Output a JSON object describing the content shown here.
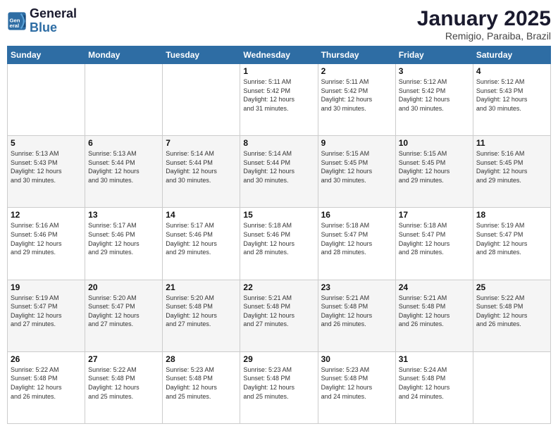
{
  "logo": {
    "line1": "General",
    "line2": "Blue"
  },
  "title": "January 2025",
  "subtitle": "Remigio, Paraiba, Brazil",
  "days_header": [
    "Sunday",
    "Monday",
    "Tuesday",
    "Wednesday",
    "Thursday",
    "Friday",
    "Saturday"
  ],
  "weeks": [
    [
      {
        "num": "",
        "info": ""
      },
      {
        "num": "",
        "info": ""
      },
      {
        "num": "",
        "info": ""
      },
      {
        "num": "1",
        "info": "Sunrise: 5:11 AM\nSunset: 5:42 PM\nDaylight: 12 hours\nand 31 minutes."
      },
      {
        "num": "2",
        "info": "Sunrise: 5:11 AM\nSunset: 5:42 PM\nDaylight: 12 hours\nand 30 minutes."
      },
      {
        "num": "3",
        "info": "Sunrise: 5:12 AM\nSunset: 5:42 PM\nDaylight: 12 hours\nand 30 minutes."
      },
      {
        "num": "4",
        "info": "Sunrise: 5:12 AM\nSunset: 5:43 PM\nDaylight: 12 hours\nand 30 minutes."
      }
    ],
    [
      {
        "num": "5",
        "info": "Sunrise: 5:13 AM\nSunset: 5:43 PM\nDaylight: 12 hours\nand 30 minutes."
      },
      {
        "num": "6",
        "info": "Sunrise: 5:13 AM\nSunset: 5:44 PM\nDaylight: 12 hours\nand 30 minutes."
      },
      {
        "num": "7",
        "info": "Sunrise: 5:14 AM\nSunset: 5:44 PM\nDaylight: 12 hours\nand 30 minutes."
      },
      {
        "num": "8",
        "info": "Sunrise: 5:14 AM\nSunset: 5:44 PM\nDaylight: 12 hours\nand 30 minutes."
      },
      {
        "num": "9",
        "info": "Sunrise: 5:15 AM\nSunset: 5:45 PM\nDaylight: 12 hours\nand 30 minutes."
      },
      {
        "num": "10",
        "info": "Sunrise: 5:15 AM\nSunset: 5:45 PM\nDaylight: 12 hours\nand 29 minutes."
      },
      {
        "num": "11",
        "info": "Sunrise: 5:16 AM\nSunset: 5:45 PM\nDaylight: 12 hours\nand 29 minutes."
      }
    ],
    [
      {
        "num": "12",
        "info": "Sunrise: 5:16 AM\nSunset: 5:46 PM\nDaylight: 12 hours\nand 29 minutes."
      },
      {
        "num": "13",
        "info": "Sunrise: 5:17 AM\nSunset: 5:46 PM\nDaylight: 12 hours\nand 29 minutes."
      },
      {
        "num": "14",
        "info": "Sunrise: 5:17 AM\nSunset: 5:46 PM\nDaylight: 12 hours\nand 29 minutes."
      },
      {
        "num": "15",
        "info": "Sunrise: 5:18 AM\nSunset: 5:46 PM\nDaylight: 12 hours\nand 28 minutes."
      },
      {
        "num": "16",
        "info": "Sunrise: 5:18 AM\nSunset: 5:47 PM\nDaylight: 12 hours\nand 28 minutes."
      },
      {
        "num": "17",
        "info": "Sunrise: 5:18 AM\nSunset: 5:47 PM\nDaylight: 12 hours\nand 28 minutes."
      },
      {
        "num": "18",
        "info": "Sunrise: 5:19 AM\nSunset: 5:47 PM\nDaylight: 12 hours\nand 28 minutes."
      }
    ],
    [
      {
        "num": "19",
        "info": "Sunrise: 5:19 AM\nSunset: 5:47 PM\nDaylight: 12 hours\nand 27 minutes."
      },
      {
        "num": "20",
        "info": "Sunrise: 5:20 AM\nSunset: 5:47 PM\nDaylight: 12 hours\nand 27 minutes."
      },
      {
        "num": "21",
        "info": "Sunrise: 5:20 AM\nSunset: 5:48 PM\nDaylight: 12 hours\nand 27 minutes."
      },
      {
        "num": "22",
        "info": "Sunrise: 5:21 AM\nSunset: 5:48 PM\nDaylight: 12 hours\nand 27 minutes."
      },
      {
        "num": "23",
        "info": "Sunrise: 5:21 AM\nSunset: 5:48 PM\nDaylight: 12 hours\nand 26 minutes."
      },
      {
        "num": "24",
        "info": "Sunrise: 5:21 AM\nSunset: 5:48 PM\nDaylight: 12 hours\nand 26 minutes."
      },
      {
        "num": "25",
        "info": "Sunrise: 5:22 AM\nSunset: 5:48 PM\nDaylight: 12 hours\nand 26 minutes."
      }
    ],
    [
      {
        "num": "26",
        "info": "Sunrise: 5:22 AM\nSunset: 5:48 PM\nDaylight: 12 hours\nand 26 minutes."
      },
      {
        "num": "27",
        "info": "Sunrise: 5:22 AM\nSunset: 5:48 PM\nDaylight: 12 hours\nand 25 minutes."
      },
      {
        "num": "28",
        "info": "Sunrise: 5:23 AM\nSunset: 5:48 PM\nDaylight: 12 hours\nand 25 minutes."
      },
      {
        "num": "29",
        "info": "Sunrise: 5:23 AM\nSunset: 5:48 PM\nDaylight: 12 hours\nand 25 minutes."
      },
      {
        "num": "30",
        "info": "Sunrise: 5:23 AM\nSunset: 5:48 PM\nDaylight: 12 hours\nand 24 minutes."
      },
      {
        "num": "31",
        "info": "Sunrise: 5:24 AM\nSunset: 5:48 PM\nDaylight: 12 hours\nand 24 minutes."
      },
      {
        "num": "",
        "info": ""
      }
    ]
  ]
}
